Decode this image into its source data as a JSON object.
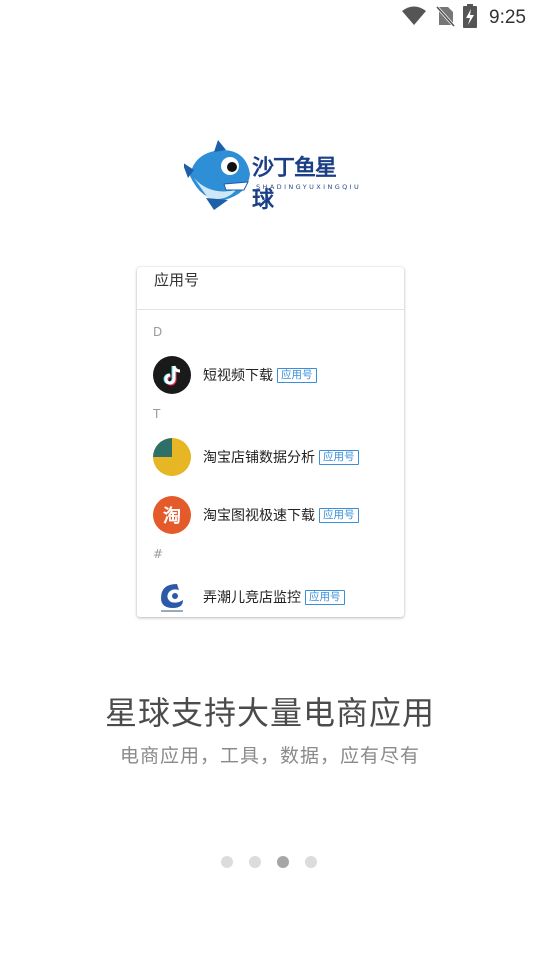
{
  "status_bar": {
    "time": "9:25",
    "icons": [
      "wifi-icon",
      "no-sim-icon",
      "battery-charging-icon"
    ]
  },
  "logo": {
    "text": "沙丁鱼星球",
    "subtext": "SHADINGYUXINGQIU"
  },
  "preview": {
    "title": "应用号",
    "sections": [
      {
        "letter": "D",
        "items": [
          {
            "label": "短视频下载",
            "tag": "应用号",
            "icon": "douyin-icon"
          }
        ]
      },
      {
        "letter": "T",
        "items": [
          {
            "label": "淘宝店铺数据分析",
            "tag": "应用号",
            "icon": "pie-chart-icon"
          },
          {
            "label": "淘宝图视极速下载",
            "tag": "应用号",
            "icon": "taobao-icon",
            "icon_text": "淘"
          }
        ]
      },
      {
        "letter": "#",
        "items": [
          {
            "label": "弄潮儿竞店监控",
            "tag": "应用号",
            "icon": "wave-logo-icon"
          }
        ]
      }
    ]
  },
  "headline": "星球支持大量电商应用",
  "subline": "电商应用，工具，数据，应有尽有",
  "pager": {
    "count": 4,
    "active": 3
  }
}
